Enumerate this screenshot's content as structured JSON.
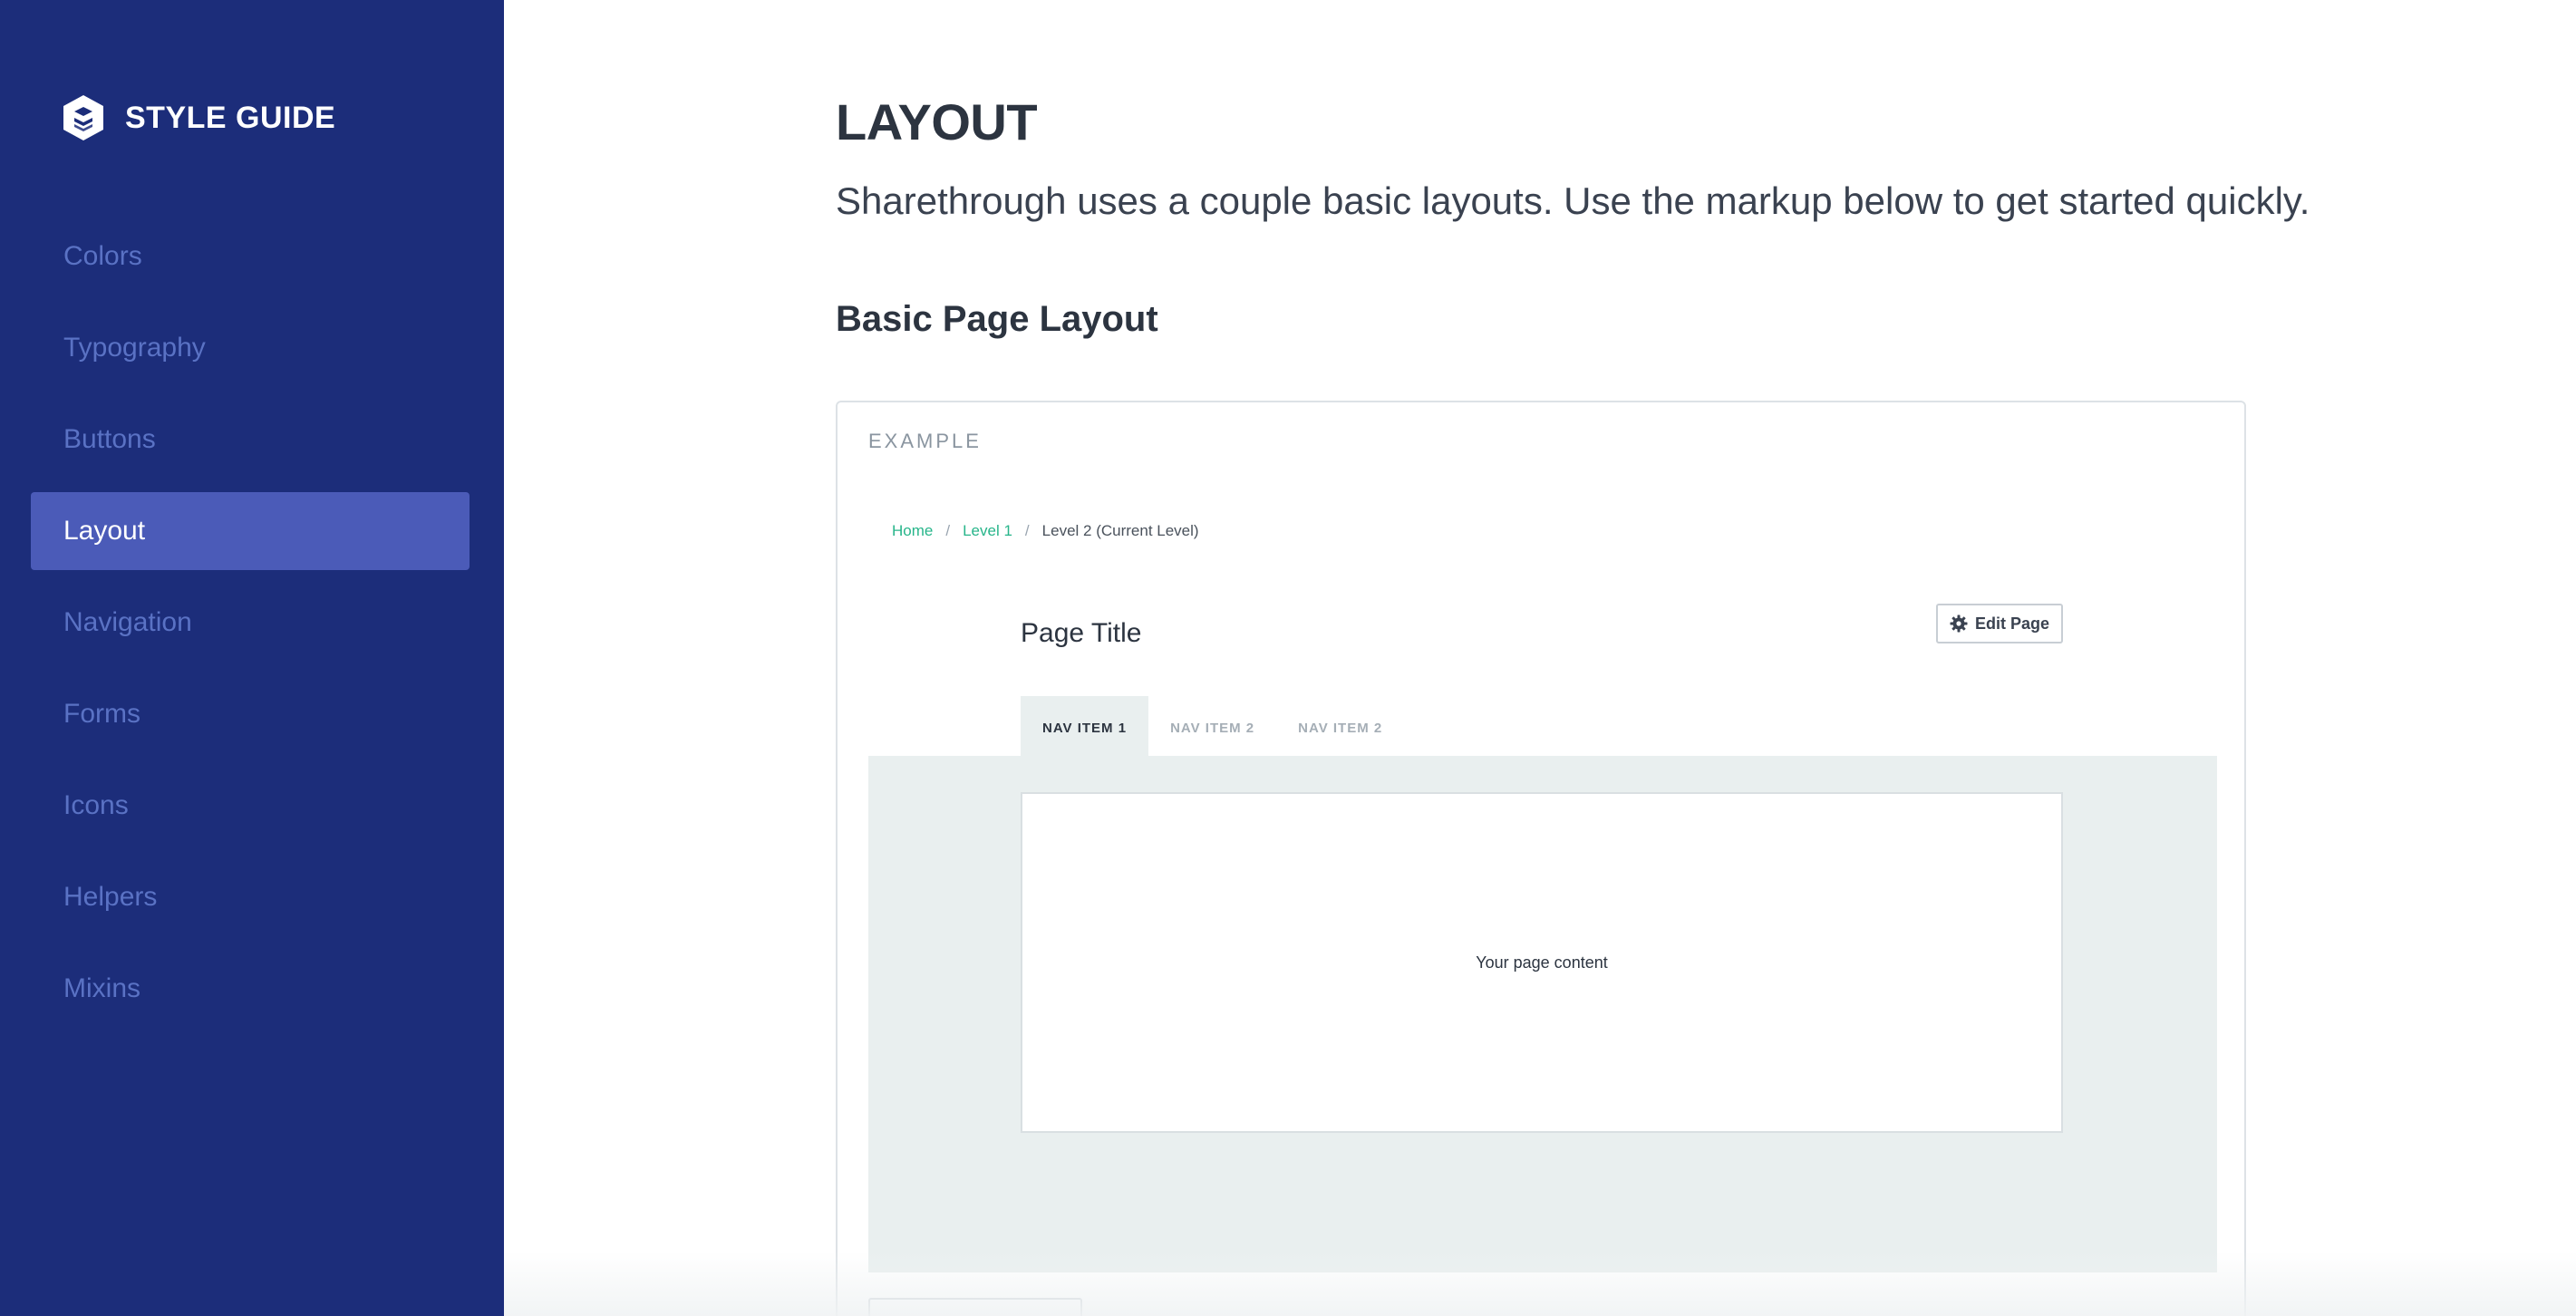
{
  "sidebar": {
    "brand_text": "STYLE GUIDE",
    "items": [
      {
        "label": "Colors",
        "active": false
      },
      {
        "label": "Typography",
        "active": false
      },
      {
        "label": "Buttons",
        "active": false
      },
      {
        "label": "Layout",
        "active": true
      },
      {
        "label": "Navigation",
        "active": false
      },
      {
        "label": "Forms",
        "active": false
      },
      {
        "label": "Icons",
        "active": false
      },
      {
        "label": "Helpers",
        "active": false
      },
      {
        "label": "Mixins",
        "active": false
      }
    ]
  },
  "main": {
    "title": "LAYOUT",
    "lead": "Sharethrough uses a couple basic layouts. Use the markup below to get started quickly.",
    "section_title": "Basic Page Layout"
  },
  "example": {
    "label": "EXAMPLE",
    "breadcrumb": {
      "home": "Home",
      "level1": "Level 1",
      "separator": "/",
      "current": "Level 2 (Current Level)"
    },
    "page_title": "Page Title",
    "edit_button": "Edit Page",
    "tabs": [
      "NAV ITEM 1",
      "NAV ITEM 2",
      "NAV ITEM 2"
    ],
    "content": "Your page content"
  },
  "colors": {
    "sidebar_bg": "#1c2d7a",
    "sidebar_active": "#4b5bb8",
    "link_green": "#27b58a"
  }
}
